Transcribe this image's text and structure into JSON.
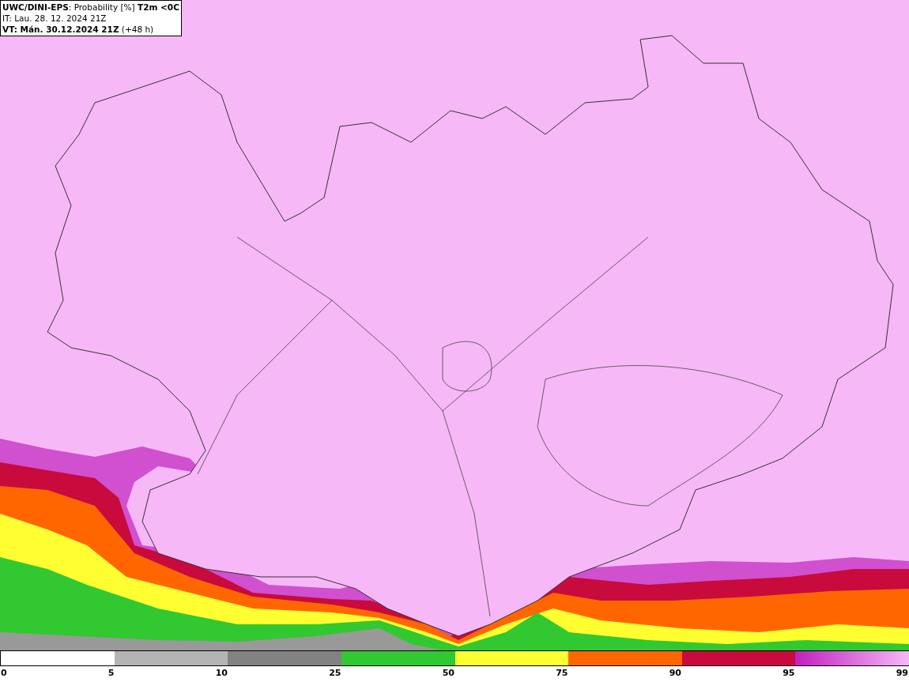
{
  "header": {
    "lines": [
      "**UWC/DINI-EPS**: Probability [%] **T2m <0C**",
      "IT: Lau. 28. 12. 2024 21Z",
      "**VT: Mán. 30.12.2024 21Z** (+48 h)"
    ]
  },
  "legend": {
    "segments": [
      {
        "color": "#ffffff"
      },
      {
        "color": "#b4b4b4"
      },
      {
        "color": "#828282"
      },
      {
        "color": "#32c832"
      },
      {
        "color": "#ffff32"
      },
      {
        "color": "#ff6600"
      },
      {
        "color": "#c80a3c"
      },
      {
        "color": "#c020c0",
        "kind": "gradient"
      }
    ],
    "ticks": [
      "0",
      "5",
      "10",
      "25",
      "50",
      "75",
      "90",
      "95",
      "99"
    ]
  }
}
